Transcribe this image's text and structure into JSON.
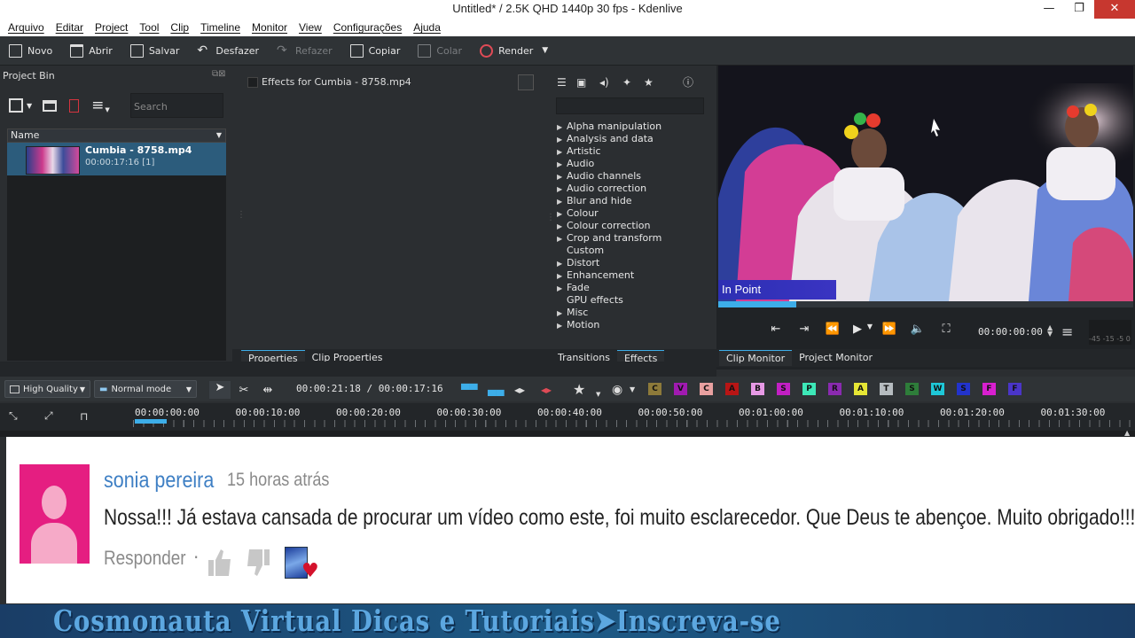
{
  "window": {
    "title": "Untitled* / 2.5K QHD 1440p 30 fps - Kdenlive",
    "buttons": {
      "minimize": "—",
      "maximize": "❐",
      "close": "✕"
    }
  },
  "menu": [
    "Arquivo",
    "Editar",
    "Project",
    "Tool",
    "Clip",
    "Timeline",
    "Monitor",
    "View",
    "Configurações",
    "Ajuda"
  ],
  "toolbar": {
    "new": "Novo",
    "open": "Abrir",
    "save": "Salvar",
    "undo": "Desfazer",
    "redo": "Refazer",
    "copy": "Copiar",
    "paste": "Colar",
    "render": "Render"
  },
  "project_bin": {
    "title": "Project Bin",
    "search_placeholder": "Search",
    "column": "Name",
    "clip": {
      "name": "Cumbia - 8758.mp4",
      "duration": "00:00:17:16  [1]"
    }
  },
  "effects_panel": {
    "title": "Effects for Cumbia - 8758.mp4"
  },
  "effects_list": [
    {
      "label": "Alpha manipulation",
      "expandable": true
    },
    {
      "label": "Analysis and data",
      "expandable": true
    },
    {
      "label": "Artistic",
      "expandable": true
    },
    {
      "label": "Audio",
      "expandable": true
    },
    {
      "label": "Audio channels",
      "expandable": true
    },
    {
      "label": "Audio correction",
      "expandable": true
    },
    {
      "label": "Blur and hide",
      "expandable": true
    },
    {
      "label": "Colour",
      "expandable": true
    },
    {
      "label": "Colour correction",
      "expandable": true
    },
    {
      "label": "Crop and transform",
      "expandable": true
    },
    {
      "label": "Custom",
      "expandable": false
    },
    {
      "label": "Distort",
      "expandable": true
    },
    {
      "label": "Enhancement",
      "expandable": true
    },
    {
      "label": "Fade",
      "expandable": true
    },
    {
      "label": "GPU effects",
      "expandable": false
    },
    {
      "label": "Misc",
      "expandable": true
    },
    {
      "label": "Motion",
      "expandable": true
    }
  ],
  "tabs": {
    "properties": "Properties",
    "clip_properties": "Clip Properties",
    "transitions": "Transitions",
    "effects": "Effects",
    "clip_monitor": "Clip Monitor",
    "project_monitor": "Project Monitor"
  },
  "monitor": {
    "overlay": "In Point",
    "timecode": "00:00:00:00",
    "vu_scale": "-45 -15 -5 0"
  },
  "timeline_toolbar": {
    "quality": "High Quality",
    "mode": "Normal mode",
    "timecode": "00:00:21:18 / 00:00:17:16",
    "labels": [
      {
        "l": "C",
        "c": "#8d7a3a"
      },
      {
        "l": "V",
        "c": "#a01ab0"
      },
      {
        "l": "C",
        "c": "#e8a0a0"
      },
      {
        "l": "A",
        "c": "#b81515"
      },
      {
        "l": "B",
        "c": "#e79ae6"
      },
      {
        "l": "S",
        "c": "#c21fc4"
      },
      {
        "l": "P",
        "c": "#3de8b8"
      },
      {
        "l": "R",
        "c": "#8a2ab0"
      },
      {
        "l": "A",
        "c": "#e6e635"
      },
      {
        "l": "T",
        "c": "#b6bcc0"
      },
      {
        "l": "S",
        "c": "#2e7d3a"
      },
      {
        "l": "W",
        "c": "#1ec8d8"
      },
      {
        "l": "S",
        "c": "#2233cc"
      },
      {
        "l": "F",
        "c": "#d81fd0"
      },
      {
        "l": "F",
        "c": "#4a35c8"
      }
    ]
  },
  "ruler": [
    "00:00:00:00",
    "00:00:10:00",
    "00:00:20:00",
    "00:00:30:00",
    "00:00:40:00",
    "00:00:50:00",
    "00:01:00:00",
    "00:01:10:00",
    "00:01:20:00",
    "00:01:30:00"
  ],
  "comment": {
    "user": "sonia pereira",
    "time": "15 horas atrás",
    "text": "Nossa!!! Já estava cansada de procurar um vídeo como este, foi muito esclarecedor. Que Deus te abençoe. Muito obrigado!!!",
    "reply": "Responder",
    "dot": "·"
  },
  "banner": {
    "text": "Cosmonauta Virtual Dicas e Tutoriais➤Inscreva-se"
  }
}
